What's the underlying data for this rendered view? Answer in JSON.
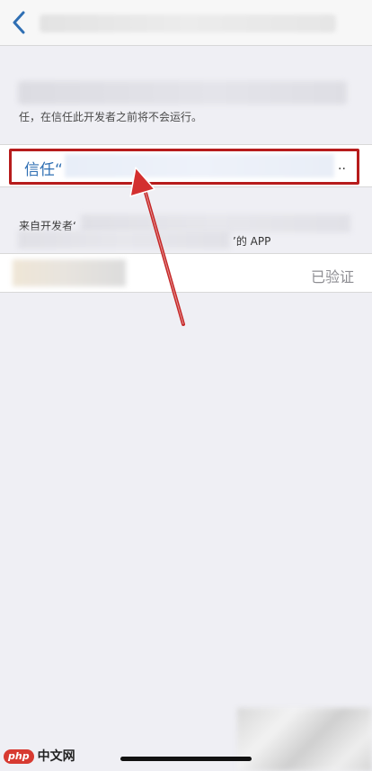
{
  "nav": {
    "back_icon": "chevron-left-icon",
    "accent_color": "#2f6fb3"
  },
  "description": {
    "line2": "任，在信任此开发者之前将不会运行。"
  },
  "trust_row": {
    "label": "信任“",
    "ellipsis": "..",
    "highlight_color": "#b71c1c"
  },
  "developer_section": {
    "line1_prefix": "来自开发者‘",
    "line2_suffix": "’的 APP"
  },
  "app_row": {
    "status": "已验证"
  },
  "watermark": {
    "badge": "php",
    "text": "中文网"
  }
}
